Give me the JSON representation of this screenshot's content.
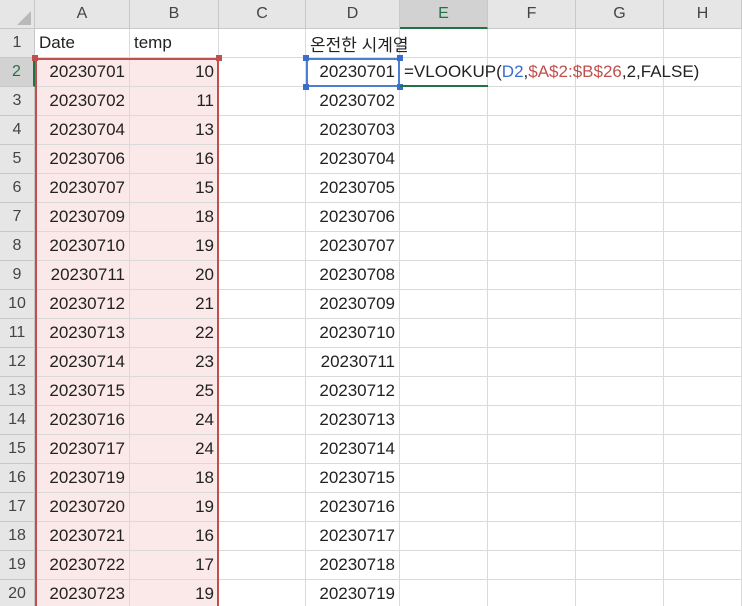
{
  "columns": [
    "A",
    "B",
    "C",
    "D",
    "E",
    "F",
    "G",
    "H"
  ],
  "rows": [
    1,
    2,
    3,
    4,
    5,
    6,
    7,
    8,
    9,
    10,
    11,
    12,
    13,
    14,
    15,
    16,
    17,
    18,
    19,
    20
  ],
  "headers": {
    "A1": "Date",
    "B1": "temp",
    "D1": "온전한 시계열"
  },
  "col_a": [
    "20230701",
    "20230702",
    "20230704",
    "20230706",
    "20230707",
    "20230709",
    "20230710",
    "20230711",
    "20230712",
    "20230713",
    "20230714",
    "20230715",
    "20230716",
    "20230717",
    "20230719",
    "20230720",
    "20230721",
    "20230722",
    "20230723"
  ],
  "col_b": [
    "10",
    "11",
    "13",
    "16",
    "15",
    "18",
    "19",
    "20",
    "21",
    "22",
    "23",
    "25",
    "24",
    "24",
    "18",
    "19",
    "16",
    "17",
    "19"
  ],
  "col_d": [
    "20230701",
    "20230702",
    "20230703",
    "20230704",
    "20230705",
    "20230706",
    "20230707",
    "20230708",
    "20230709",
    "20230710",
    "20230711",
    "20230712",
    "20230713",
    "20230714",
    "20230715",
    "20230716",
    "20230717",
    "20230718",
    "20230719"
  ],
  "formula": {
    "cell": "E2",
    "parts": [
      "=VLOOKUP(",
      "D2",
      ",",
      "$A$2:$B$26",
      ",2,FALSE)"
    ]
  },
  "colors": {
    "range_border": "#c0504d",
    "range_fill": "#fbe8e8",
    "ref_d2": "#3b6ec8",
    "active_header": "#217346"
  }
}
